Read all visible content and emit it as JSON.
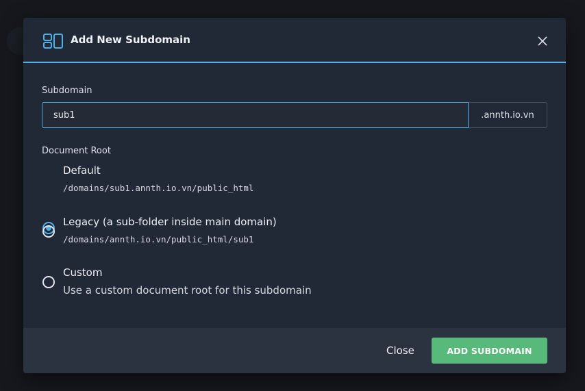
{
  "modal": {
    "title": "Add New Subdomain",
    "header_icon": "layout-icon",
    "close_icon": "close-icon"
  },
  "form": {
    "subdomain_label": "Subdomain",
    "subdomain_value": "sub1",
    "domain_suffix": ".annth.io.vn",
    "docroot_label": "Document Root",
    "options": [
      {
        "title": "Default",
        "subtitle": "/domains/sub1.annth.io.vn/public_html",
        "checked": true
      },
      {
        "title": "Legacy (a sub-folder inside main domain)",
        "subtitle": "/domains/annth.io.vn/public_html/sub1",
        "checked": false
      },
      {
        "title": "Custom",
        "subtitle": "Use a custom document root for this subdomain",
        "checked": false
      }
    ]
  },
  "footer": {
    "close_label": "Close",
    "add_label": "ADD SUBDOMAIN"
  },
  "colors": {
    "accent": "#4fb1e8",
    "primary_button": "#57b97a",
    "modal_bg": "#212937",
    "footer_bg": "#2b3341"
  }
}
